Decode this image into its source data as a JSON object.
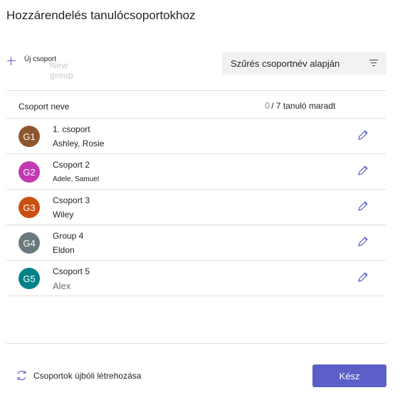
{
  "dialog": {
    "title": "Hozzárendelés tanulócsoportokhoz"
  },
  "toolbar": {
    "new_group_label": "Új csoport",
    "new_group_ghost": "New group",
    "filter_placeholder": "Szűrés csoportnév alapján"
  },
  "table": {
    "column_header": "Csoport neve",
    "remaining_count": "0",
    "remaining_label": "/ 7 tanuló maradt"
  },
  "groups": [
    {
      "initials": "G1",
      "name": "1. csoport",
      "members": "Ashley, Rosie",
      "color": "#8e562e"
    },
    {
      "initials": "G2",
      "name": "Csoport 2",
      "members": "Adele, Samuel",
      "color": "#c239b3"
    },
    {
      "initials": "G3",
      "name": "Csoport 3",
      "members": "Wiley",
      "color": "#ca5010"
    },
    {
      "initials": "G4",
      "name": "Group 4",
      "members": "Eldon",
      "color": "#69797e"
    },
    {
      "initials": "G5",
      "name": "Csoport 5",
      "members": "Alex",
      "color": "#038387"
    }
  ],
  "footer": {
    "regenerate_label": "Csoportok újbóli létrehozása",
    "done_label": "Kész"
  },
  "colors": {
    "accent": "#5b5fc7",
    "divider": "#e1dfdd",
    "filter_bg": "#f3f2f1"
  },
  "icons": {
    "add": "plus-icon",
    "filter": "filter-icon",
    "edit": "pencil-icon",
    "regenerate": "refresh-icon"
  }
}
